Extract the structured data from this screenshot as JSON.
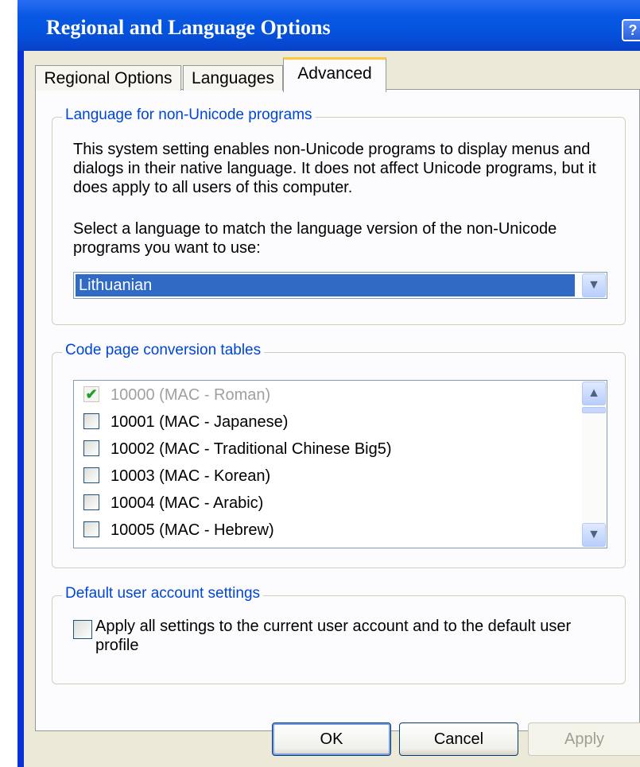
{
  "window": {
    "title": "Regional and Language Options",
    "help_btn": "?",
    "close_btn": "✕"
  },
  "tabs": [
    {
      "label": "Regional Options",
      "active": false
    },
    {
      "label": "Languages",
      "active": false
    },
    {
      "label": "Advanced",
      "active": true
    }
  ],
  "non_unicode": {
    "legend": "Language for non-Unicode programs",
    "description": "This system setting enables non-Unicode programs to display menus and dialogs in their native language. It does not affect Unicode programs, but it does apply to all users of this computer.",
    "select_label": "Select a language to match the language version of the non-Unicode programs you want to use:",
    "selected_language": "Lithuanian",
    "dropdown_icon": "chevron-down-icon"
  },
  "code_pages": {
    "legend": "Code page conversion tables",
    "items": [
      {
        "label": "10000 (MAC - Roman)",
        "checked": true,
        "disabled": true
      },
      {
        "label": "10001 (MAC - Japanese)",
        "checked": false,
        "disabled": false
      },
      {
        "label": "10002 (MAC - Traditional Chinese Big5)",
        "checked": false,
        "disabled": false
      },
      {
        "label": "10003 (MAC - Korean)",
        "checked": false,
        "disabled": false
      },
      {
        "label": "10004 (MAC - Arabic)",
        "checked": false,
        "disabled": false
      },
      {
        "label": "10005 (MAC - Hebrew)",
        "checked": false,
        "disabled": false
      }
    ]
  },
  "default_user": {
    "legend": "Default user account settings",
    "checkbox_label": "Apply all settings to the current user account and to the default user profile",
    "checked": false
  },
  "buttons": {
    "ok": "OK",
    "cancel": "Cancel",
    "apply": "Apply"
  },
  "colors": {
    "titlebar": "#0454e0",
    "legend_text": "#0046d5",
    "selection": "#316ac5",
    "dialog_bg": "#ece9d8"
  }
}
